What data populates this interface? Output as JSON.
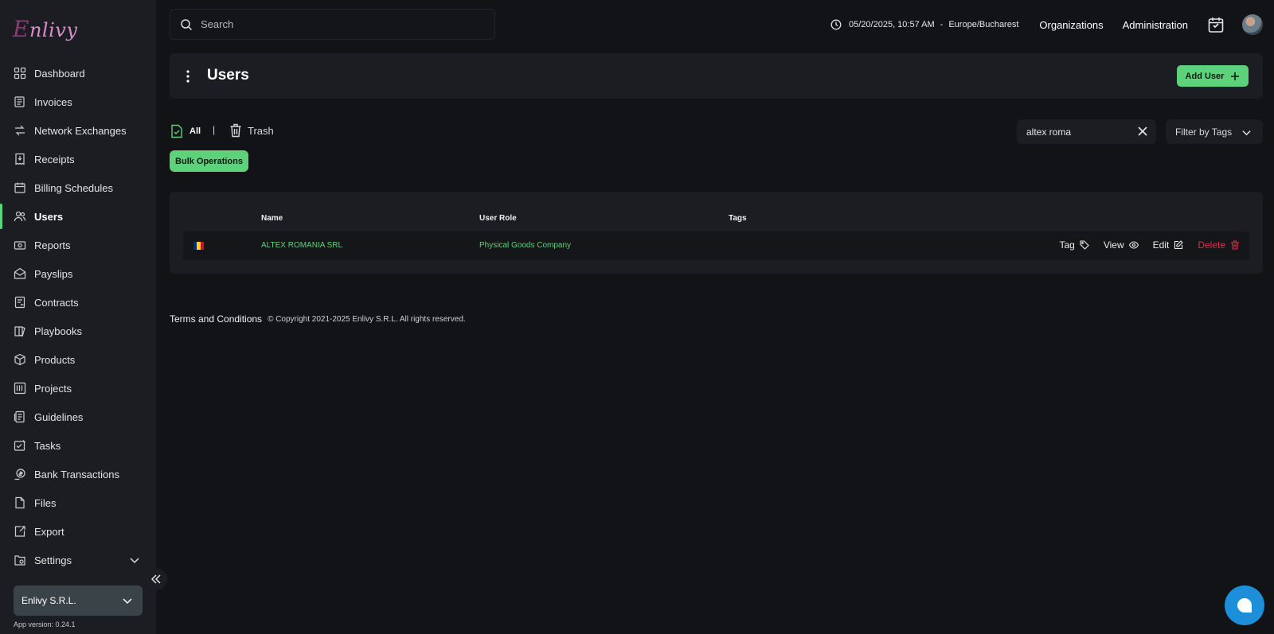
{
  "app": {
    "logo_text": "Enlivy"
  },
  "sidebar": {
    "items": [
      {
        "label": "Dashboard",
        "icon": "dashboard-icon"
      },
      {
        "label": "Invoices",
        "icon": "invoice-icon"
      },
      {
        "label": "Network Exchanges",
        "icon": "exchange-icon"
      },
      {
        "label": "Receipts",
        "icon": "receipt-icon"
      },
      {
        "label": "Billing Schedules",
        "icon": "billing-icon"
      },
      {
        "label": "Users",
        "icon": "users-icon",
        "active": true
      },
      {
        "label": "Reports",
        "icon": "reports-icon"
      },
      {
        "label": "Payslips",
        "icon": "payslip-icon"
      },
      {
        "label": "Contracts",
        "icon": "contract-icon"
      },
      {
        "label": "Playbooks",
        "icon": "playbook-icon"
      },
      {
        "label": "Products",
        "icon": "product-icon"
      },
      {
        "label": "Projects",
        "icon": "project-icon"
      },
      {
        "label": "Guidelines",
        "icon": "guidelines-icon"
      },
      {
        "label": "Tasks",
        "icon": "tasks-icon"
      },
      {
        "label": "Bank Transactions",
        "icon": "bank-icon"
      },
      {
        "label": "Files",
        "icon": "file-icon"
      },
      {
        "label": "Export",
        "icon": "export-icon"
      },
      {
        "label": "Settings",
        "icon": "settings-icon",
        "expandable": true
      }
    ],
    "organization": "Enlivy S.R.L.",
    "app_version": "App version: 0.24.1"
  },
  "topbar": {
    "search_placeholder": "Search",
    "datetime": "05/20/2025, 10:57 AM",
    "separator": "-",
    "timezone": "Europe/Bucharest",
    "links": [
      "Organizations",
      "Administration"
    ]
  },
  "page": {
    "title": "Users",
    "add_button": "Add User",
    "filters": {
      "all": "All",
      "separator": "|",
      "trash": "Trash"
    },
    "bulk_button": "Bulk Operations",
    "search_value": "altex roma",
    "tag_filter": "Filter by Tags"
  },
  "table": {
    "headers": {
      "name": "Name",
      "role": "User Role",
      "tags": "Tags"
    },
    "rows": [
      {
        "flag_colors": [
          "#002b7f",
          "#fcd116",
          "#ce1126"
        ],
        "name": "ALTEX ROMANIA SRL",
        "role": "Physical Goods Company",
        "actions": {
          "tag": "Tag",
          "view": "View",
          "edit": "Edit",
          "delete": "Delete"
        }
      }
    ]
  },
  "footer": {
    "terms": "Terms and Conditions",
    "copyright": "© Copyright 2021-2025 Enlivy S.R.L. All rights reserved."
  },
  "colors": {
    "accent": "#5dd27a",
    "danger": "#d73348",
    "chat": "#1c8fd8"
  }
}
